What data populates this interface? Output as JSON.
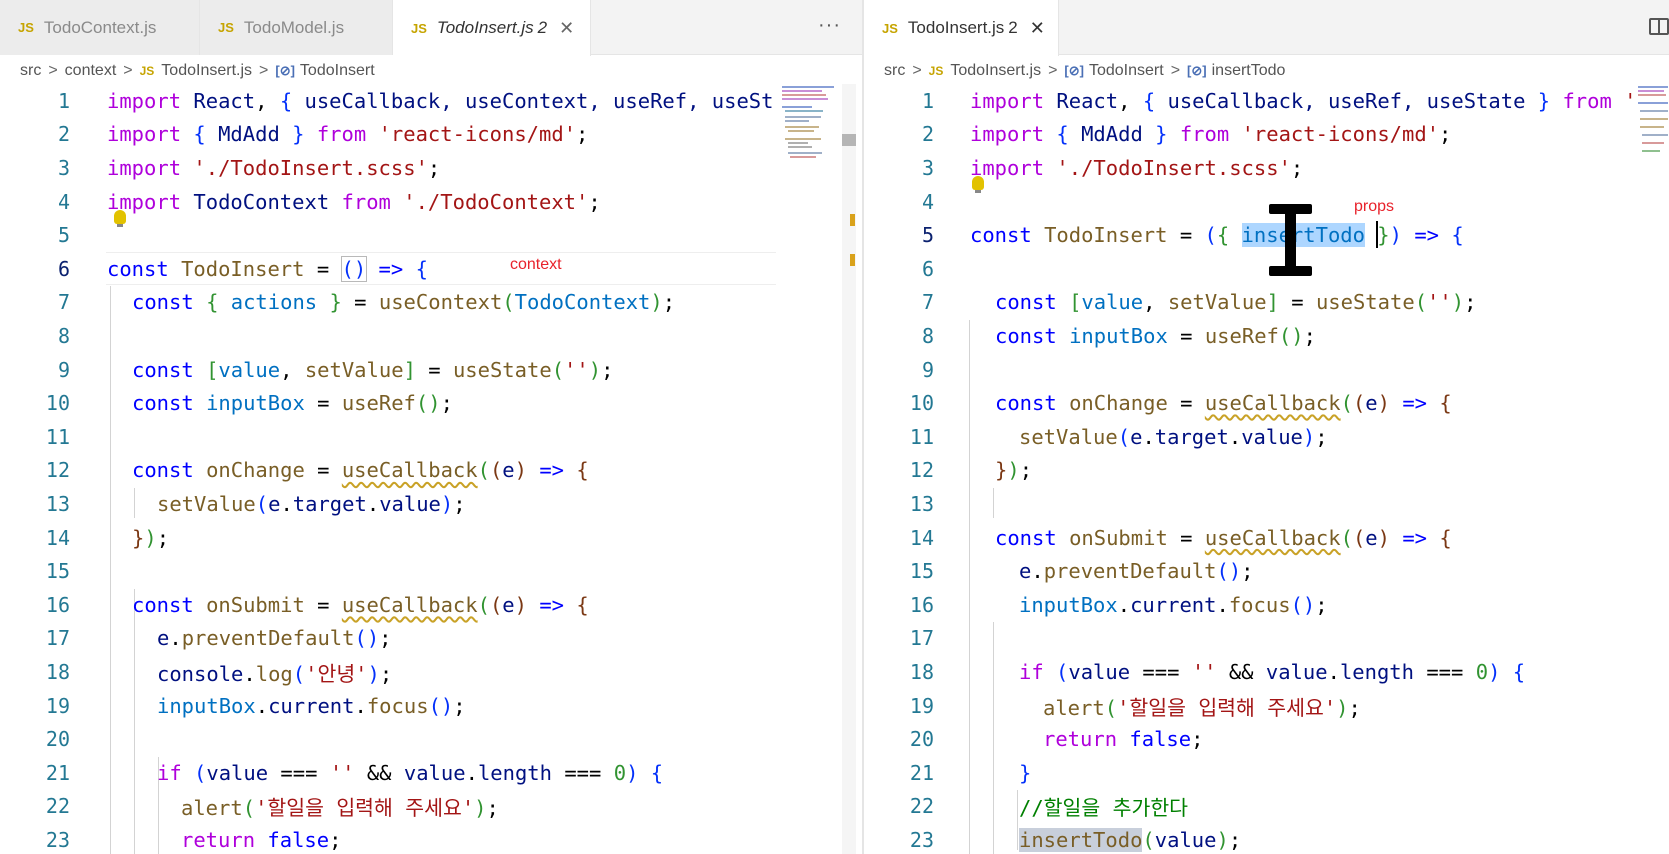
{
  "colors": {
    "keyword": "#0000ff",
    "control": "#af00db",
    "variable": "#001080",
    "function": "#795e26",
    "string": "#a31515",
    "comment": "#008000",
    "line_number": "#237893",
    "annotation": "#e8222b",
    "selection": "#add6ff"
  },
  "left": {
    "tabs": [
      {
        "icon": "JS",
        "name": "TodoContext.js"
      },
      {
        "icon": "JS",
        "name": "TodoModel.js"
      },
      {
        "icon": "JS",
        "name": "TodoInsert.js",
        "badge": "2",
        "close": "✕"
      }
    ],
    "more": "···",
    "breadcrumb": {
      "root": "src",
      "folder": "context",
      "file": "TodoInsert.js",
      "symbol": "TodoInsert"
    },
    "annotation": "context",
    "lines": [
      "1",
      "2",
      "3",
      "4",
      "5",
      "6",
      "7",
      "8",
      "9",
      "10",
      "11",
      "12",
      "13",
      "14",
      "15",
      "16",
      "17",
      "18",
      "19",
      "20",
      "21",
      "22",
      "23"
    ],
    "code": {
      "l1": {
        "import": "import",
        "react": "React",
        "p1": ", ",
        "ob": "{",
        "names": " useCallback, useContext, useRef, useSt"
      },
      "l2": {
        "import": "import",
        "ob": "{",
        "name": " MdAdd ",
        "cb": "}",
        "from": "from",
        "str": "'react-icons/md'",
        "semi": ";"
      },
      "l3": {
        "import": "import",
        "str": "'./TodoInsert.scss'",
        "semi": ";"
      },
      "l4": {
        "import": "import",
        "name": "TodoContext",
        "from": "from",
        "str": "'./TodoContext'",
        "semi": ";"
      },
      "l6": {
        "const": "const",
        "name": "TodoInsert",
        "eq": " = ",
        "parens": "()",
        "arrow": "=>",
        "ob": "{"
      },
      "l7": {
        "const": "const",
        "ob": "{",
        "actions": " actions ",
        "cb": "}",
        "eq": " = ",
        "fn": "useContext",
        "po": "(",
        "arg": "TodoContext",
        "pc": ")",
        "semi": ";"
      },
      "l9": {
        "const": "const",
        "bo": "[",
        "value": "value",
        "comma": ", ",
        "setter": "setValue",
        "bc": "]",
        "eq": " = ",
        "fn": "useState",
        "po": "(",
        "str": "''",
        "pc": ")",
        "semi": ";"
      },
      "l10": {
        "const": "const",
        "name": "inputBox",
        "eq": " = ",
        "fn": "useRef",
        "parens": "()",
        "semi": ";"
      },
      "l12": {
        "const": "const",
        "name": "onChange",
        "eq": " = ",
        "fn": "useCallback",
        "po": "(",
        "p2": "(",
        "arg": "e",
        "p2c": ")",
        "arrow": "=>",
        "ob": "{"
      },
      "l13": {
        "fn": "setValue",
        "po": "(",
        "e": "e",
        "dot1": ".",
        "target": "target",
        "dot2": ".",
        "value": "value",
        "pc": ")",
        "semi": ";"
      },
      "l14": {
        "cb": "}",
        "pc": ")",
        "semi": ";"
      },
      "l16": {
        "const": "const",
        "name": "onSubmit",
        "eq": " = ",
        "fn": "useCallback",
        "po": "(",
        "p2": "(",
        "arg": "e",
        "p2c": ")",
        "arrow": "=>",
        "ob": "{"
      },
      "l17": {
        "e": "e",
        "dot": ".",
        "fn": "preventDefault",
        "parens": "()",
        "semi": ";"
      },
      "l18": {
        "obj": "console",
        "dot": ".",
        "fn": "log",
        "po": "(",
        "str": "'안녕'",
        "pc": ")",
        "semi": ";"
      },
      "l19": {
        "obj": "inputBox",
        "dot1": ".",
        "cur": "current",
        "dot2": ".",
        "fn": "focus",
        "parens": "()",
        "semi": ";"
      },
      "l21": {
        "if": "if",
        "po": "(",
        "v": "value",
        "eq1": " === ",
        "str": "''",
        "and": " && ",
        "v2": "value",
        "dot": ".",
        "len": "length",
        "eq2": " === ",
        "num": "0",
        "pc": ")",
        "ob": "{"
      },
      "l22": {
        "fn": "alert",
        "po": "(",
        "str": "'할일을 입력해 주세요'",
        "pc": ")",
        "semi": ";"
      },
      "l23": {
        "ret": "return",
        "val": "false",
        "semi": ";"
      }
    }
  },
  "right": {
    "tab": {
      "icon": "JS",
      "name": "TodoInsert.js",
      "badge": "2",
      "close": "✕"
    },
    "breadcrumb": {
      "root": "src",
      "file": "TodoInsert.js",
      "symbol1": "TodoInsert",
      "symbol2": "insertTodo"
    },
    "annotation": "props",
    "lines": [
      "1",
      "2",
      "3",
      "4",
      "5",
      "6",
      "7",
      "8",
      "9",
      "10",
      "11",
      "12",
      "13",
      "14",
      "15",
      "16",
      "17",
      "18",
      "19",
      "20",
      "21",
      "22",
      "23"
    ],
    "code": {
      "l1": {
        "import": "import",
        "react": "React",
        "p1": ", ",
        "ob": "{",
        "names": " useCallback, useRef, useState ",
        "cb": "}",
        "from": "from",
        "tail": " '"
      },
      "l2": {
        "import": "import",
        "ob": "{",
        "name": " MdAdd ",
        "cb": "}",
        "from": "from",
        "str": "'react-icons/md'",
        "semi": ";"
      },
      "l3": {
        "import": "import",
        "str": "'./TodoInsert.scss'",
        "semi": ";"
      },
      "l5": {
        "const": "const",
        "name": "TodoInsert",
        "eq": " = ",
        "po": "(",
        "ob": "{ ",
        "param": "insertTodo",
        "cb": " }",
        "pc": ")",
        "arrow": "=>",
        "ob2": "{"
      },
      "l7": {
        "const": "const",
        "bo": "[",
        "value": "value",
        "comma": ", ",
        "setter": "setValue",
        "bc": "]",
        "eq": " = ",
        "fn": "useState",
        "po": "(",
        "str": "''",
        "pc": ")",
        "semi": ";"
      },
      "l8": {
        "const": "const",
        "name": "inputBox",
        "eq": " = ",
        "fn": "useRef",
        "parens": "()",
        "semi": ";"
      },
      "l10": {
        "const": "const",
        "name": "onChange",
        "eq": " = ",
        "fn": "useCallback",
        "po": "(",
        "p2": "(",
        "arg": "e",
        "p2c": ")",
        "arrow": "=>",
        "ob": "{"
      },
      "l11": {
        "fn": "setValue",
        "po": "(",
        "e": "e",
        "dot1": ".",
        "target": "target",
        "dot2": ".",
        "value": "value",
        "pc": ")",
        "semi": ";"
      },
      "l12": {
        "cb": "}",
        "pc": ")",
        "semi": ";"
      },
      "l14": {
        "const": "const",
        "name": "onSubmit",
        "eq": " = ",
        "fn": "useCallback",
        "po": "(",
        "p2": "(",
        "arg": "e",
        "p2c": ")",
        "arrow": "=>",
        "ob": "{"
      },
      "l15": {
        "e": "e",
        "dot": ".",
        "fn": "preventDefault",
        "parens": "()",
        "semi": ";"
      },
      "l16": {
        "obj": "inputBox",
        "dot1": ".",
        "cur": "current",
        "dot2": ".",
        "fn": "focus",
        "parens": "()",
        "semi": ";"
      },
      "l18": {
        "if": "if",
        "po": "(",
        "v": "value",
        "eq1": " === ",
        "str": "''",
        "and": " && ",
        "v2": "value",
        "dot": ".",
        "len": "length",
        "eq2": " === ",
        "num": "0",
        "pc": ")",
        "ob": "{"
      },
      "l19": {
        "fn": "alert",
        "po": "(",
        "str": "'할일을 입력해 주세요'",
        "pc": ")",
        "semi": ";"
      },
      "l20": {
        "ret": "return",
        "val": "false",
        "semi": ";"
      },
      "l21": {
        "cb": "}"
      },
      "l22": {
        "comment": "//할일을 추가한다"
      },
      "l23": {
        "fn": "insertTodo",
        "po": "(",
        "arg": "value",
        "pc": ")",
        "semi": ";"
      }
    }
  }
}
